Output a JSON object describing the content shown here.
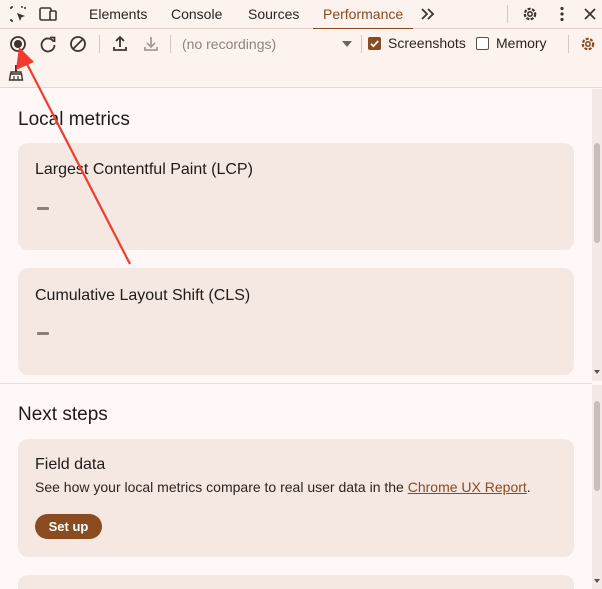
{
  "tabs": [
    {
      "label": "Elements"
    },
    {
      "label": "Console"
    },
    {
      "label": "Sources"
    },
    {
      "label": "Performance",
      "active": true
    }
  ],
  "toolbar": {
    "recordings_placeholder": "(no recordings)",
    "screenshots_label": "Screenshots",
    "screenshots_checked": true,
    "memory_label": "Memory",
    "memory_checked": false
  },
  "local_metrics": {
    "heading": "Local metrics",
    "cards": [
      {
        "title": "Largest Contentful Paint (LCP)",
        "value": "–"
      },
      {
        "title": "Cumulative Layout Shift (CLS)",
        "value": "–"
      }
    ]
  },
  "next_steps": {
    "heading": "Next steps",
    "field_data": {
      "title": "Field data",
      "description_prefix": "See how your local metrics compare to real user data in the ",
      "link_text": "Chrome UX Report",
      "description_suffix": ".",
      "button_label": "Set up"
    }
  },
  "colors": {
    "accent": "#8a4b20",
    "card_bg": "#f5e7e2",
    "annotation": "#f03c2c"
  },
  "icons": [
    "inspect-element-icon",
    "device-toggle-icon",
    "more-tabs-icon",
    "settings-icon",
    "more-options-icon",
    "close-icon",
    "record-icon",
    "reload-record-icon",
    "clear-icon",
    "upload-icon",
    "download-icon",
    "capture-settings-icon",
    "garbage-collect-icon"
  ]
}
